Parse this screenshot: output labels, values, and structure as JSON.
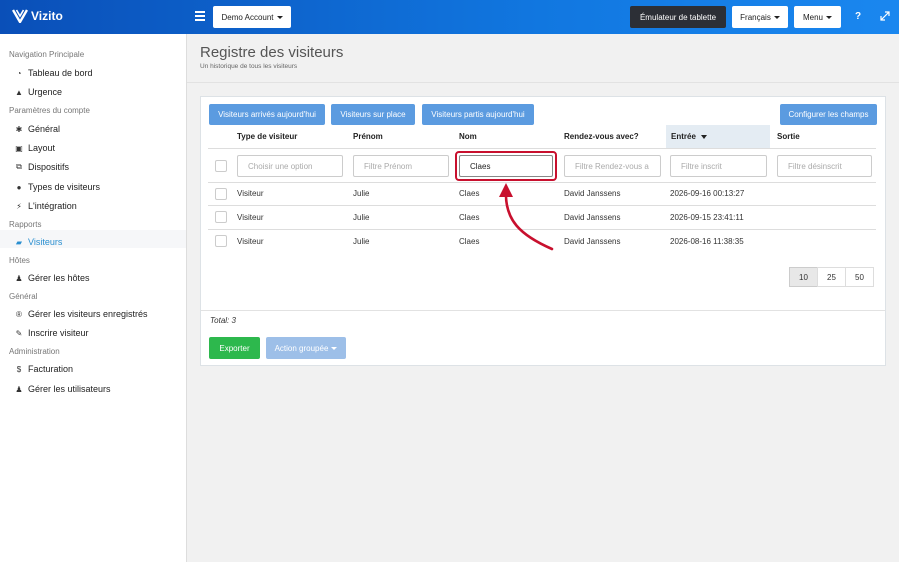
{
  "app": {
    "name": "Vizito"
  },
  "topbar": {
    "account_button": "Demo Account",
    "tablet_button": "Émulateur de tablette",
    "language_button": "Français",
    "menu_button": "Menu",
    "help_icon": "question-icon",
    "expand_icon": "expand-icon"
  },
  "sidebar": {
    "sections": [
      {
        "title": "Navigation Principale",
        "items": [
          {
            "label": "Tableau de bord",
            "icon": "gauge-icon"
          },
          {
            "label": "Urgence",
            "icon": "warning-icon"
          }
        ]
      },
      {
        "title": "Paramètres du compte",
        "items": [
          {
            "label": "Général",
            "icon": "gear-icon"
          },
          {
            "label": "Layout",
            "icon": "image-icon"
          },
          {
            "label": "Dispositifs",
            "icon": "sitemap-icon"
          },
          {
            "label": "Types de visiteurs",
            "icon": "users-icon"
          },
          {
            "label": "L'intégration",
            "icon": "plug-icon"
          }
        ]
      },
      {
        "title": "Rapports",
        "items": [
          {
            "label": "Visiteurs",
            "icon": "book-icon",
            "active": true
          }
        ]
      },
      {
        "title": "Hôtes",
        "items": [
          {
            "label": "Gérer les hôtes",
            "icon": "user-icon"
          }
        ]
      },
      {
        "title": "Général",
        "items": [
          {
            "label": "Gérer les visiteurs enregistrés",
            "icon": "registered-icon"
          },
          {
            "label": "Inscrire visiteur",
            "icon": "pencil-icon"
          }
        ]
      },
      {
        "title": "Administration",
        "items": [
          {
            "label": "Facturation",
            "icon": "dollar-icon"
          },
          {
            "label": "Gérer les utilisateurs",
            "icon": "user-plus-icon"
          }
        ]
      }
    ]
  },
  "page": {
    "title": "Registre des visiteurs",
    "subtitle": "Un historique de tous les visiteurs"
  },
  "filters": {
    "arrived_today": "Visiteurs arrivés aujourd'hui",
    "on_site": "Visiteurs sur place",
    "left_today": "Visiteurs partis aujourd'hui",
    "configure": "Configurer les champs"
  },
  "table": {
    "headers": [
      "Type de visiteur",
      "Prénom",
      "Nom",
      "Rendez-vous avec?",
      "Entrée",
      "Sortie"
    ],
    "sorted_column": "Entrée",
    "filter_inputs": {
      "type_placeholder": "Choisir une option",
      "firstname_placeholder": "Filtre Prénom",
      "lastname_value": "Claes",
      "appointment_placeholder": "Filtre Rendez-vous a",
      "checkin_placeholder": "Filtre inscrit",
      "checkout_placeholder": "Filtre désinscrit"
    },
    "rows": [
      [
        "Visiteur",
        "Julie",
        "Claes",
        "David Janssens",
        "2026-09-16 00:13:27",
        ""
      ],
      [
        "Visiteur",
        "Julie",
        "Claes",
        "David Janssens",
        "2026-09-15 23:41:11",
        ""
      ],
      [
        "Visiteur",
        "Julie",
        "Claes",
        "David Janssens",
        "2026-08-16 11:38:35",
        ""
      ]
    ],
    "page_sizes": [
      "10",
      "25",
      "50"
    ],
    "active_page_size": "10",
    "total": "Total: 3"
  },
  "actions": {
    "export": "Exporter",
    "bulk": "Action groupée"
  },
  "colors": {
    "accent": "#2a8fd0",
    "button_blue": "#5b9be0",
    "export_green": "#2db84d",
    "highlight_red": "#c8102e"
  }
}
